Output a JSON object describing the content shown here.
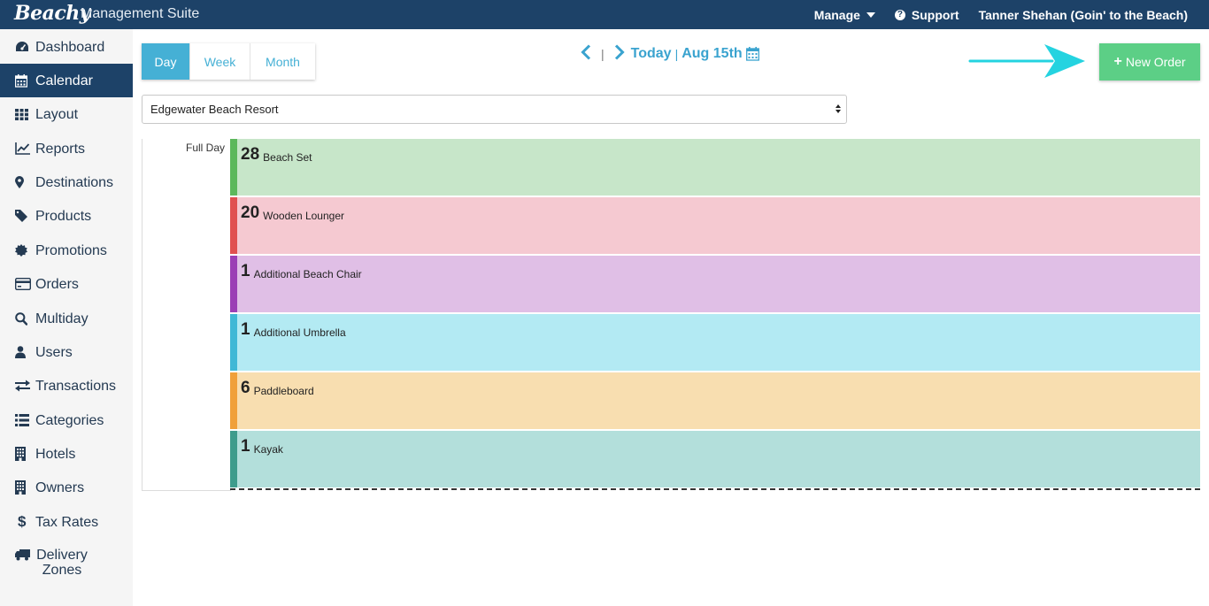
{
  "app": {
    "logo": "Beachy",
    "suite_title": "Management Suite"
  },
  "topnav": {
    "manage": "Manage",
    "support": "Support",
    "user": "Tanner Shehan (Goin' to the Beach)"
  },
  "sidebar": {
    "items": [
      {
        "label": "Dashboard",
        "icon": "dashboard-icon"
      },
      {
        "label": "Calendar",
        "icon": "calendar-icon",
        "active": true
      },
      {
        "label": "Layout",
        "icon": "grid-icon"
      },
      {
        "label": "Reports",
        "icon": "line-chart-icon"
      },
      {
        "label": "Destinations",
        "icon": "map-marker-icon"
      },
      {
        "label": "Products",
        "icon": "tag-icon"
      },
      {
        "label": "Promotions",
        "icon": "certificate-icon"
      },
      {
        "label": "Orders",
        "icon": "credit-card-icon"
      },
      {
        "label": "Multiday",
        "icon": "search-icon"
      },
      {
        "label": "Users",
        "icon": "user-icon"
      },
      {
        "label": "Transactions",
        "icon": "exchange-icon"
      },
      {
        "label": "Categories",
        "icon": "list-icon"
      },
      {
        "label": "Hotels",
        "icon": "building-icon"
      },
      {
        "label": "Owners",
        "icon": "building-icon"
      },
      {
        "label": "Tax Rates",
        "icon": "dollar-icon"
      },
      {
        "label": "Delivery Zones",
        "icon": "truck-icon"
      }
    ]
  },
  "views": {
    "day": "Day",
    "week": "Week",
    "month": "Month",
    "active": "Day"
  },
  "datenav": {
    "separator": "|",
    "today": "Today",
    "date": "Aug 15th"
  },
  "new_order": "New Order",
  "location": {
    "selected": "Edgewater Beach Resort"
  },
  "calendar": {
    "full_day_label": "Full Day",
    "events": [
      {
        "qty": "28",
        "name": "Beach Set",
        "color": "#c7e6c9",
        "accent": "#5cb85c"
      },
      {
        "qty": "20",
        "name": "Wooden Lounger",
        "color": "#f5c9d1",
        "accent": "#e05050"
      },
      {
        "qty": "1",
        "name": "Additional Beach Chair",
        "color": "#e0bfe6",
        "accent": "#9b3fb5"
      },
      {
        "qty": "1",
        "name": "Additional Umbrella",
        "color": "#b3eaf3",
        "accent": "#3fb8d6"
      },
      {
        "qty": "6",
        "name": "Paddleboard",
        "color": "#f8deb0",
        "accent": "#f0a03a"
      },
      {
        "qty": "1",
        "name": "Kayak",
        "color": "#b3dfdb",
        "accent": "#3e9c8c"
      }
    ]
  },
  "colors": {
    "topbar": "#1d4268",
    "accent_blue": "#45b0d5",
    "new_order_green": "#5ccf86",
    "annotation_arrow": "#24d3e0"
  }
}
